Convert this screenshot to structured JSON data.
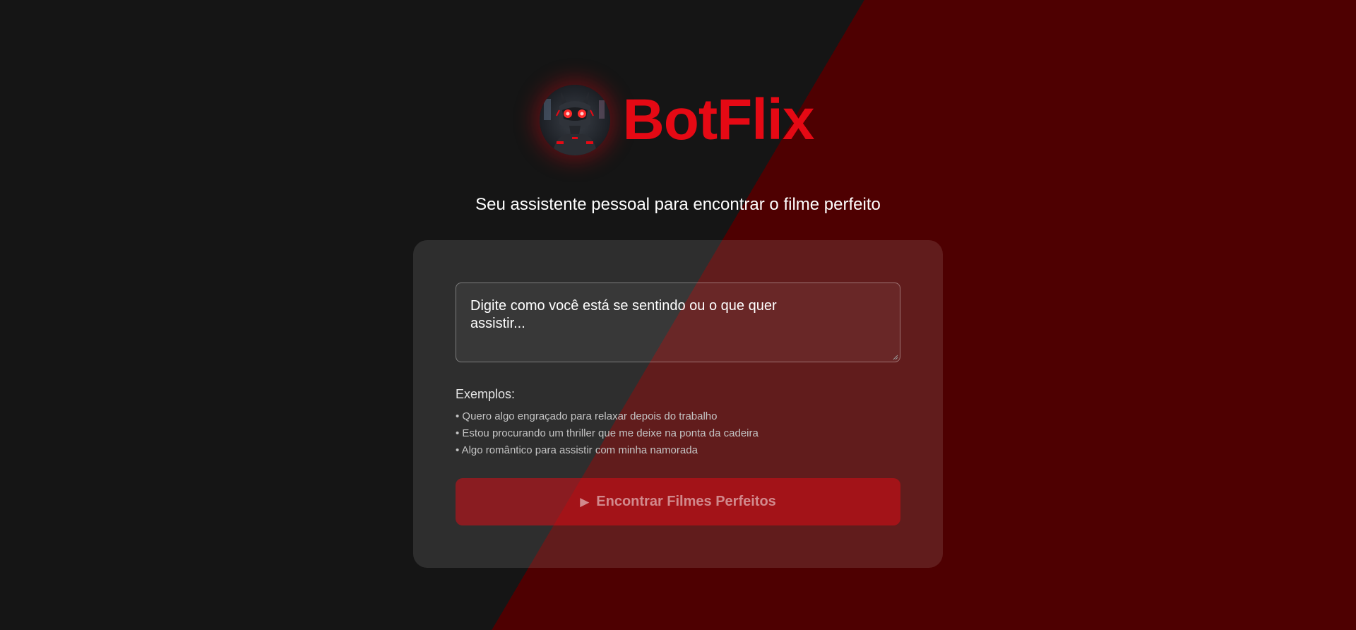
{
  "brand": {
    "name": "BotFlix",
    "logo_icon": "robot-avatar-icon",
    "accent_color": "#e50914"
  },
  "subtitle": "Seu assistente pessoal para encontrar o filme perfeito",
  "form": {
    "placeholder": "Digite como você está se sentindo ou o que quer assistir...",
    "examples_title": "Exemplos:",
    "examples": [
      "• Quero algo engraçado para relaxar depois do trabalho",
      "• Estou procurando um thriller que me deixe na ponta da cadeira",
      "• Algo romântico para assistir com minha namorada"
    ],
    "submit": {
      "icon": "play-icon",
      "icon_glyph": "▶",
      "label": "Encontrar Filmes Perfeitos"
    }
  },
  "colors": {
    "background_dark": "#151515",
    "background_red": "#4e0001"
  }
}
